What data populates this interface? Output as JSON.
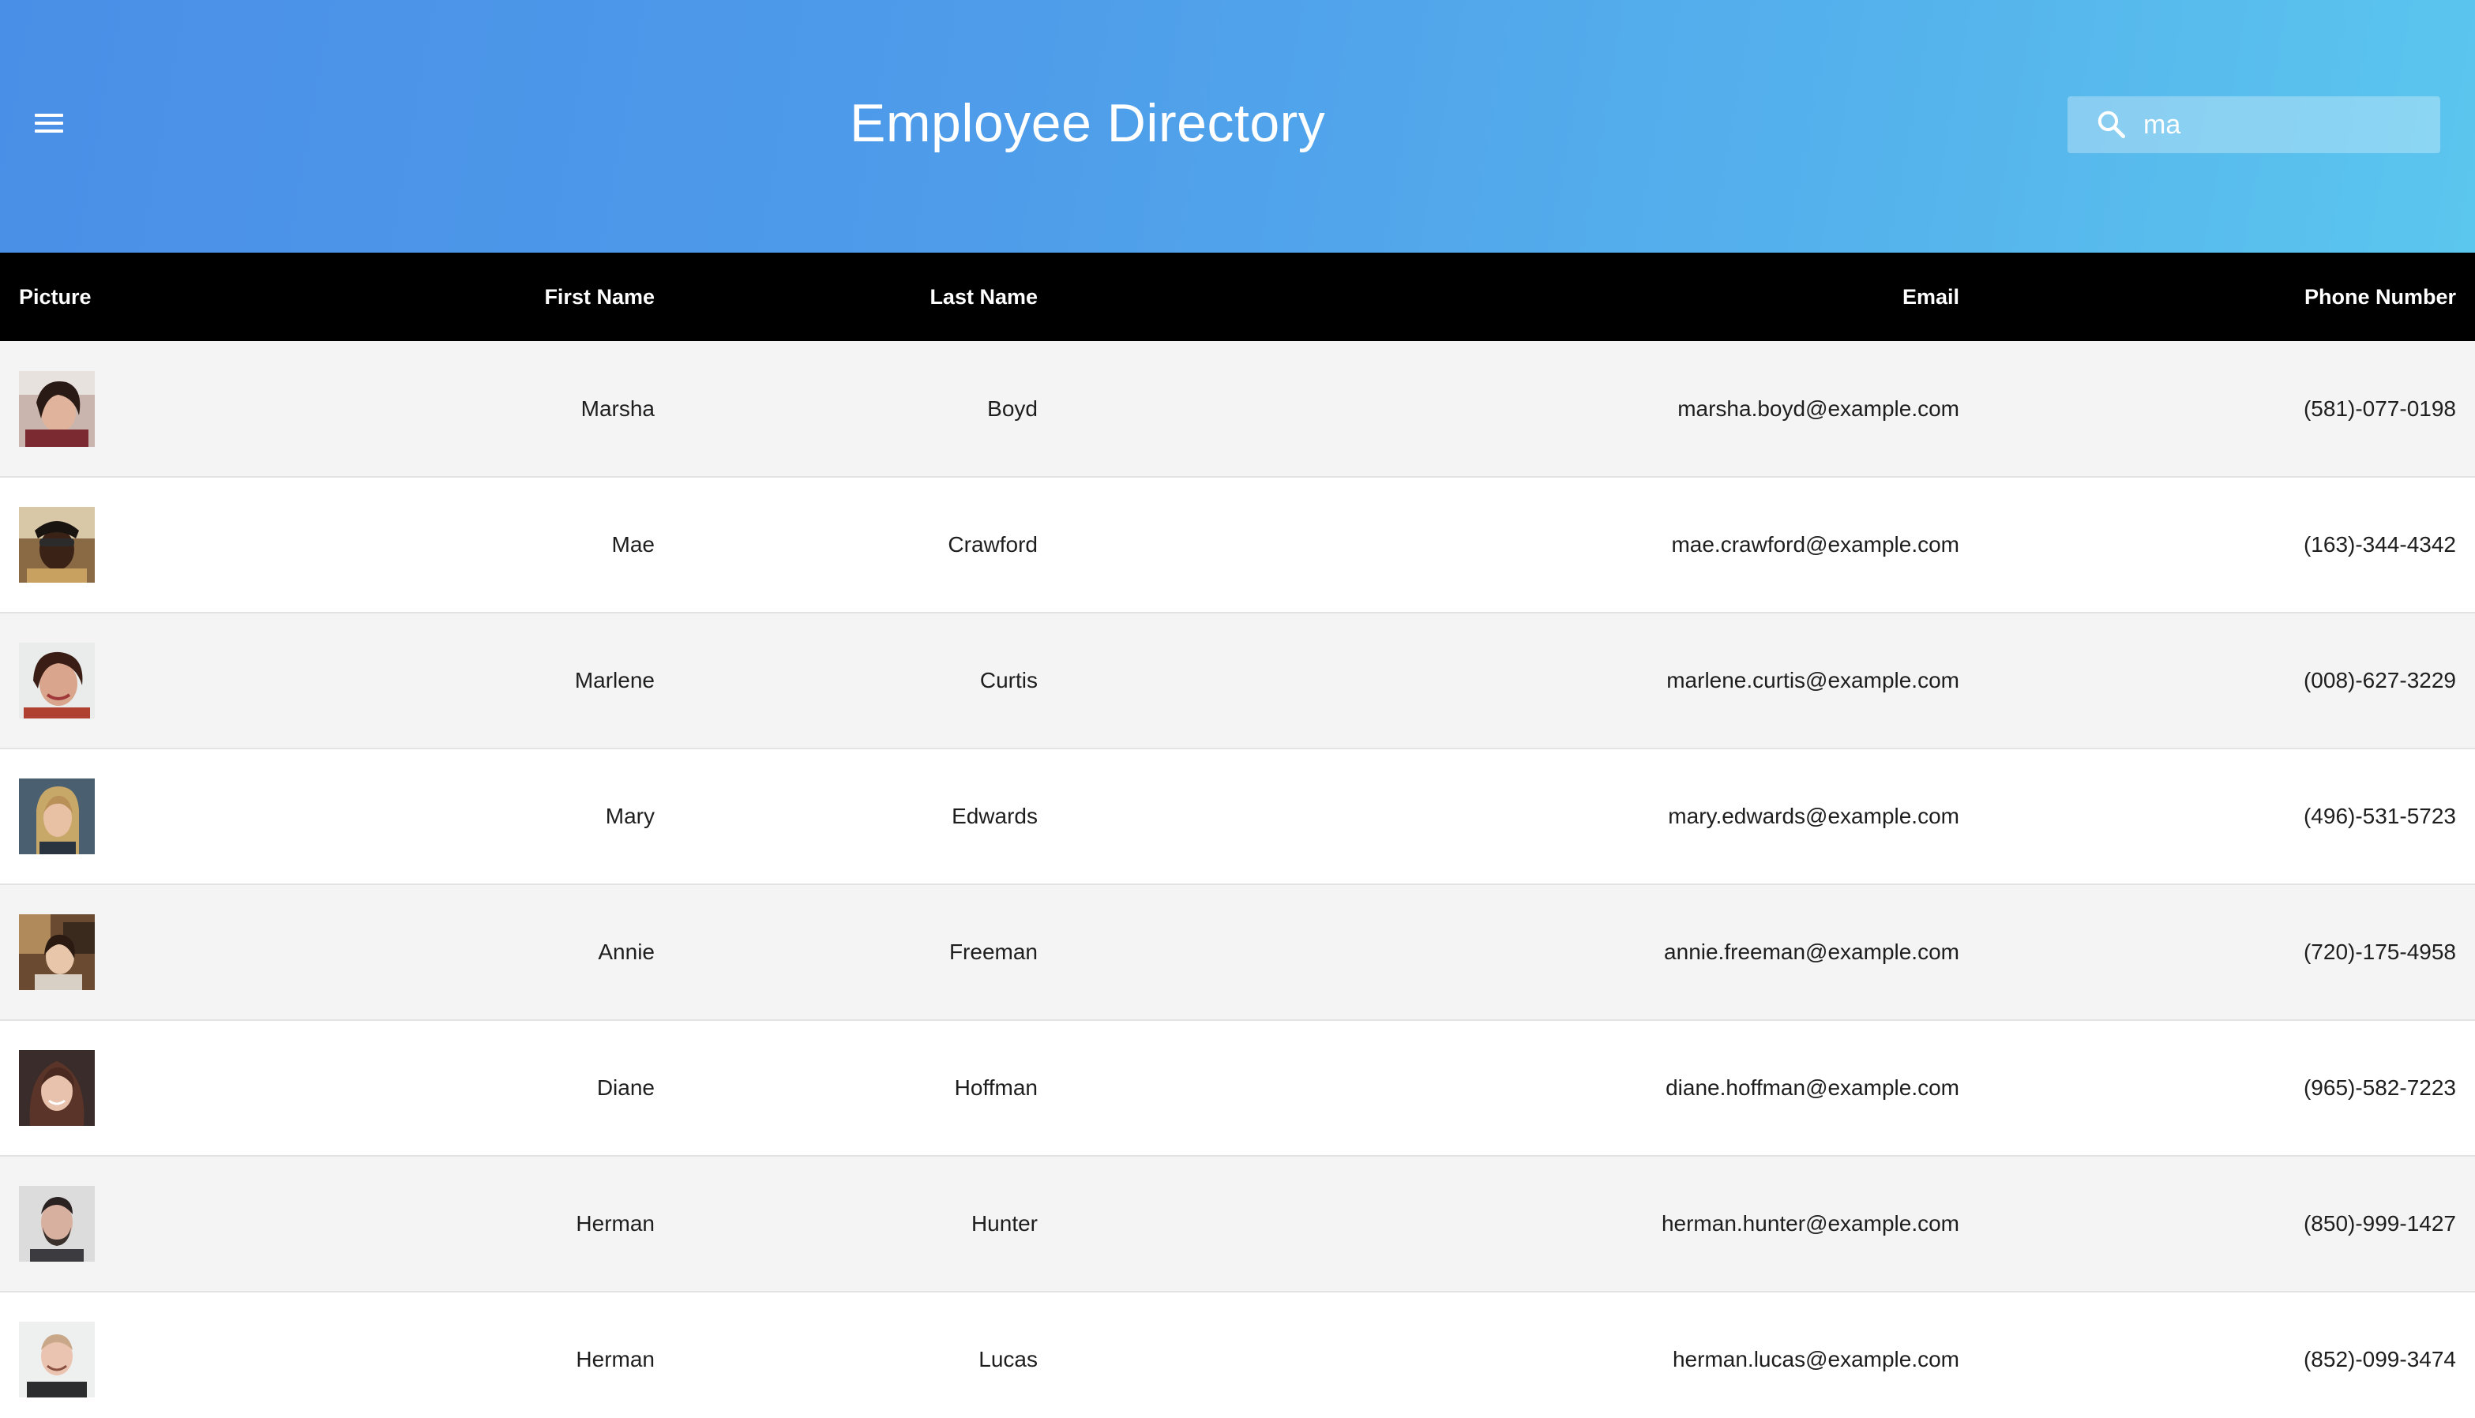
{
  "header": {
    "title": "Employee Directory",
    "menu_icon": "hamburger-menu-icon",
    "search": {
      "icon": "search-icon",
      "value": "ma",
      "placeholder": ""
    }
  },
  "table": {
    "columns": {
      "picture": "Picture",
      "first_name": "First Name",
      "last_name": "Last Name",
      "email": "Email",
      "phone": "Phone Number"
    },
    "rows": [
      {
        "first": "Marsha",
        "last": "Boyd",
        "email": "marsha.boyd@example.com",
        "phone": "(581)-077-0198"
      },
      {
        "first": "Mae",
        "last": "Crawford",
        "email": "mae.crawford@example.com",
        "phone": "(163)-344-4342"
      },
      {
        "first": "Marlene",
        "last": "Curtis",
        "email": "marlene.curtis@example.com",
        "phone": "(008)-627-3229"
      },
      {
        "first": "Mary",
        "last": "Edwards",
        "email": "mary.edwards@example.com",
        "phone": "(496)-531-5723"
      },
      {
        "first": "Annie",
        "last": "Freeman",
        "email": "annie.freeman@example.com",
        "phone": "(720)-175-4958"
      },
      {
        "first": "Diane",
        "last": "Hoffman",
        "email": "diane.hoffman@example.com",
        "phone": "(965)-582-7223"
      },
      {
        "first": "Herman",
        "last": "Hunter",
        "email": "herman.hunter@example.com",
        "phone": "(850)-999-1427"
      },
      {
        "first": "Herman",
        "last": "Lucas",
        "email": "herman.lucas@example.com",
        "phone": "(852)-099-3474"
      }
    ]
  },
  "colors": {
    "header_gradient_start": "#4a8fe7",
    "header_gradient_end": "#5bc6ee",
    "table_header_bg": "#000000",
    "row_odd_bg": "#f4f4f4",
    "row_even_bg": "#ffffff"
  }
}
